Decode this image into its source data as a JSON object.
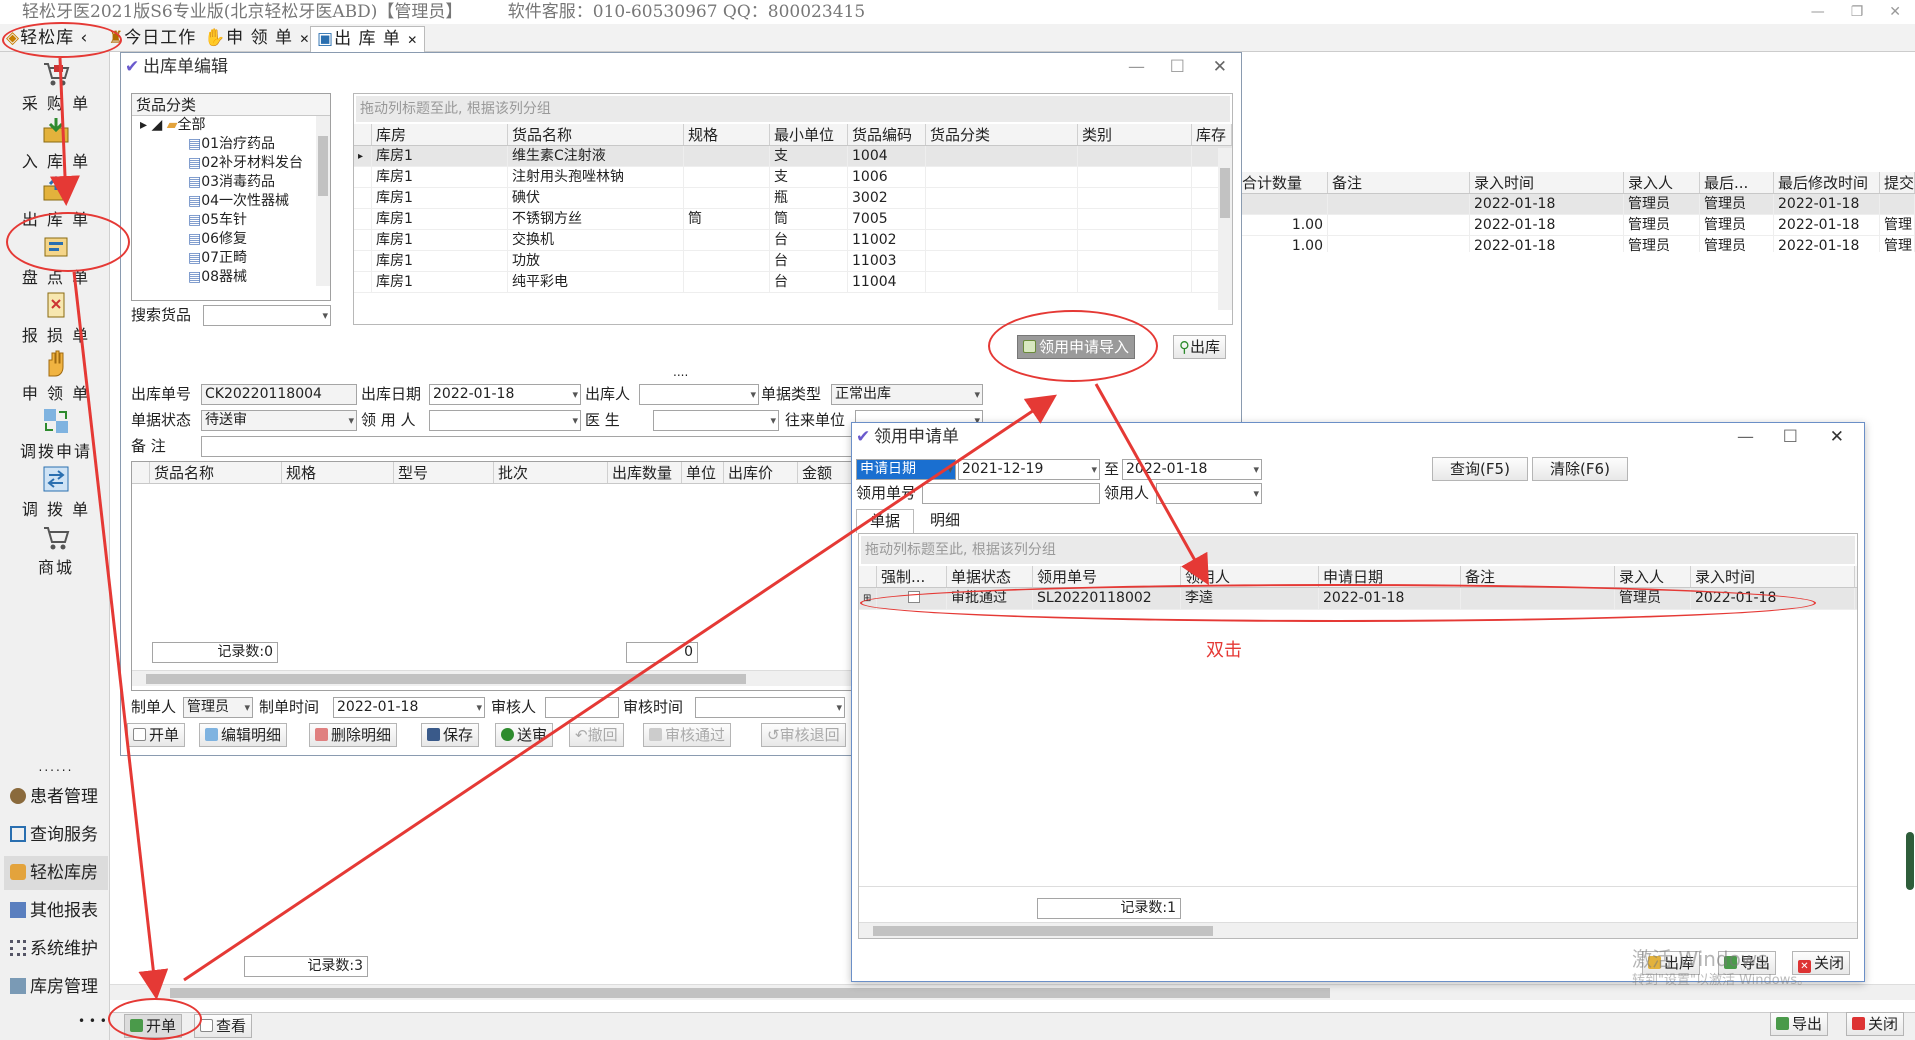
{
  "app": {
    "title": "轻松牙医2021版S6专业版(北京轻松牙医ABD)【管理员】",
    "service": "软件客服：010-60530967  QQ：800023415"
  },
  "tabs": {
    "home": "轻松库",
    "today": "今日工作",
    "apply": "申 领 单",
    "outbound": "出 库 单"
  },
  "sidebar": {
    "items": [
      {
        "label": "采 购 单",
        "icon": "cart-icon"
      },
      {
        "label": "入 库 单",
        "icon": "inbox-icon"
      },
      {
        "label": "出 库 单",
        "icon": "outbox-icon"
      },
      {
        "label": "盘 点 单",
        "icon": "inventory-icon"
      },
      {
        "label": "报 损 单",
        "icon": "report-icon"
      },
      {
        "label": "申 领 单",
        "icon": "hand-icon"
      },
      {
        "label": "调拨申请",
        "icon": "transfer-request-icon"
      },
      {
        "label": "调 拨 单",
        "icon": "transfer-icon"
      },
      {
        "label": "商城",
        "icon": "shop-icon"
      }
    ],
    "more": "......",
    "modules": [
      "患者管理",
      "查询服务",
      "轻松库房",
      "其他报表",
      "系统维护",
      "库房管理"
    ]
  },
  "outbound_editor": {
    "title": "出库单编辑",
    "tree_header": "货品分类",
    "tree": [
      "全部",
      "01治疗药品",
      "02补牙材料发台",
      "03消毒药品",
      "04一次性器械",
      "05车针",
      "06修复",
      "07正畸",
      "08器械"
    ],
    "search_label": "搜索货品",
    "group_hint": "拖动列标题至此, 根据该列分组",
    "goods_columns": [
      "库房",
      "货品名称",
      "规格",
      "最小单位",
      "货品编码",
      "货品分类",
      "类别",
      "库存"
    ],
    "goods_rows": [
      [
        "库房1",
        "维生素C注射液",
        "",
        "支",
        "1004",
        "",
        ""
      ],
      [
        "库房1",
        "注射用头孢唑林钠",
        "",
        "支",
        "1006",
        "",
        ""
      ],
      [
        "库房1",
        "碘伏",
        "",
        "瓶",
        "3002",
        "",
        ""
      ],
      [
        "库房1",
        "不锈钢方丝",
        "筒",
        "筒",
        "7005",
        "",
        ""
      ],
      [
        "库房1",
        "交换机",
        "",
        "台",
        "11002",
        "",
        ""
      ],
      [
        "库房1",
        "功放",
        "",
        "台",
        "11003",
        "",
        ""
      ],
      [
        "库房1",
        "纯平彩电",
        "",
        "台",
        "11004",
        "",
        ""
      ]
    ],
    "import_button": "领用申请导入",
    "out_button": "出库",
    "splitter": "....",
    "form": {
      "no_label": "出库单号",
      "no_value": "CK20220118004",
      "date_label": "出库日期",
      "date_value": "2022-01-18",
      "person_label": "出库人",
      "person_value": "",
      "type_label": "单据类型",
      "type_value": "正常出库",
      "status_label": "单据状态",
      "status_value": "待送审",
      "receiver_label": "领 用 人",
      "receiver_value": "",
      "doctor_label": "医    生",
      "doctor_value": "",
      "unit_label": "往来单位",
      "unit_value": "",
      "remark_label": "备    注",
      "remark_value": ""
    },
    "detail_columns": [
      "货品名称",
      "规格",
      "型号",
      "批次",
      "出库数量",
      "单位",
      "出库价",
      "金额"
    ],
    "detail_count": "记录数:0",
    "detail_sum": "0",
    "maker_label": "制单人",
    "maker_value": "管理员",
    "make_time_label": "制单时间",
    "make_time_value": "2022-01-18",
    "auditor_label": "审核人",
    "auditor_value": "",
    "audit_time_label": "审核时间",
    "audit_time_value": "",
    "buttons": [
      "开单",
      "编辑明细",
      "删除明细",
      "保存",
      "送审",
      "撤回",
      "审核通过",
      "审核退回"
    ]
  },
  "bg_list": {
    "columns": [
      "合计数量",
      "备注",
      "录入时间",
      "录入人",
      "最后...",
      "最后修改时间",
      "提交"
    ],
    "rows": [
      [
        "",
        "",
        "2022-01-18",
        "管理员",
        "管理员",
        "2022-01-18",
        ""
      ],
      [
        "1.00",
        "",
        "2022-01-18",
        "管理员",
        "管理员",
        "2022-01-18",
        "管理"
      ],
      [
        "1.00",
        "",
        "2022-01-18",
        "管理员",
        "管理员",
        "2022-01-18",
        "管理"
      ]
    ],
    "count": "记录数:3"
  },
  "apply_dialog": {
    "title": "领用申请单",
    "date_type": "申请日期",
    "date_from": "2021-12-19",
    "to_label": "至",
    "date_to": "2022-01-18",
    "no_label": "领用单号",
    "receiver_label": "领用人",
    "query_button": "查询(F5)",
    "clear_button": "清除(F6)",
    "tabs": [
      "单据",
      "明细"
    ],
    "group_hint": "拖动列标题至此, 根据该列分组",
    "columns": [
      "强制...",
      "单据状态",
      "领用单号",
      "领用人",
      "申请日期",
      "备注",
      "录入人",
      "录入时间"
    ],
    "rows": [
      [
        "",
        "审批通过",
        "SL20220118002",
        "李逵",
        "2022-01-18",
        "",
        "管理员",
        "2022-01-18"
      ]
    ],
    "count": "记录数:1",
    "buttons": [
      "出库",
      "导出",
      "关闭"
    ]
  },
  "annotation": {
    "double_click": "双击"
  },
  "watermark": {
    "line1": "激活 Windows",
    "line2": "转到\"设置\"以激活 Windows。"
  },
  "bottom_bar": {
    "new": "开单",
    "view": "查看",
    "export": "导出",
    "close": "关闭",
    "dots": "• • •"
  },
  "colors": {
    "accent_red": "#e53935",
    "selected_row": "#e6e6e6",
    "highlight_blue": "#1a6fd0"
  }
}
